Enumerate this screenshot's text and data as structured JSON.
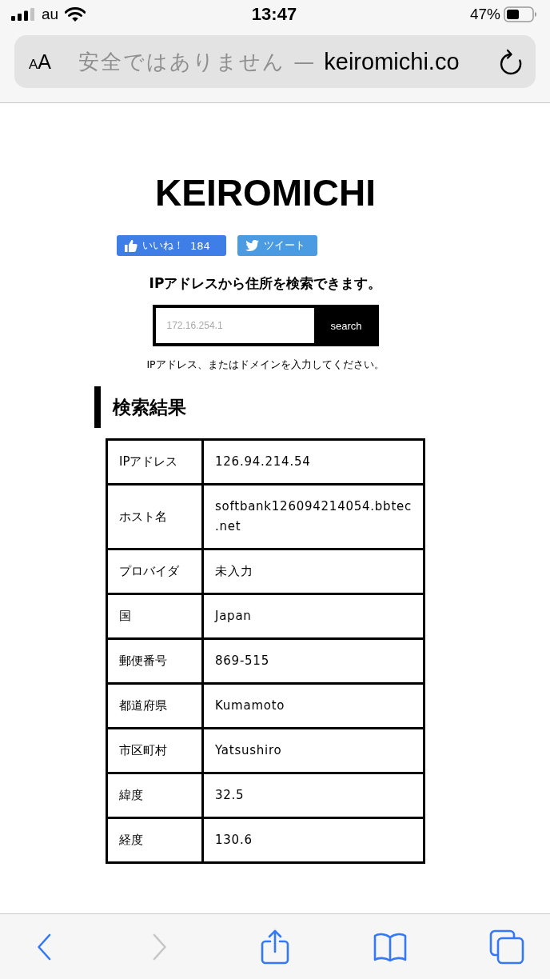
{
  "status_bar": {
    "carrier": "au",
    "time": "13:47",
    "battery": "47%"
  },
  "address_bar": {
    "format_button": "AA",
    "security_note": "安全ではありません —",
    "domain": "keiromichi.co"
  },
  "page": {
    "title": "KEIROMICHI",
    "share_buttons": [
      {
        "kind": "like",
        "label": "いいね！",
        "count": "184"
      },
      {
        "kind": "tweet",
        "label": "ツイート"
      }
    ],
    "tagline": "IPアドレスから住所を検索できます。",
    "search": {
      "placeholder": "172.16.254.1",
      "button": "search"
    },
    "hint": "IPアドレス、またはドメインを入力してください。",
    "results_heading": "検索結果",
    "results": [
      {
        "label": "IPアドレス",
        "value": "126.94.214.54"
      },
      {
        "label": "ホスト名",
        "value": "softbank126094214054.bbtec.net"
      },
      {
        "label": "プロバイダ",
        "value": "未入力"
      },
      {
        "label": "国",
        "value": "Japan"
      },
      {
        "label": "郵便番号",
        "value": "869-515"
      },
      {
        "label": "都道府県",
        "value": "Kumamoto"
      },
      {
        "label": "市区町村",
        "value": "Yatsushiro"
      },
      {
        "label": "緯度",
        "value": "32.5"
      },
      {
        "label": "経度",
        "value": "130.6"
      }
    ]
  },
  "toolbar": [
    {
      "kind": "back",
      "disabled": false
    },
    {
      "kind": "forward",
      "disabled": true
    },
    {
      "kind": "share",
      "disabled": false
    },
    {
      "kind": "bookmarks",
      "disabled": false
    },
    {
      "kind": "tabs",
      "disabled": false
    }
  ]
}
